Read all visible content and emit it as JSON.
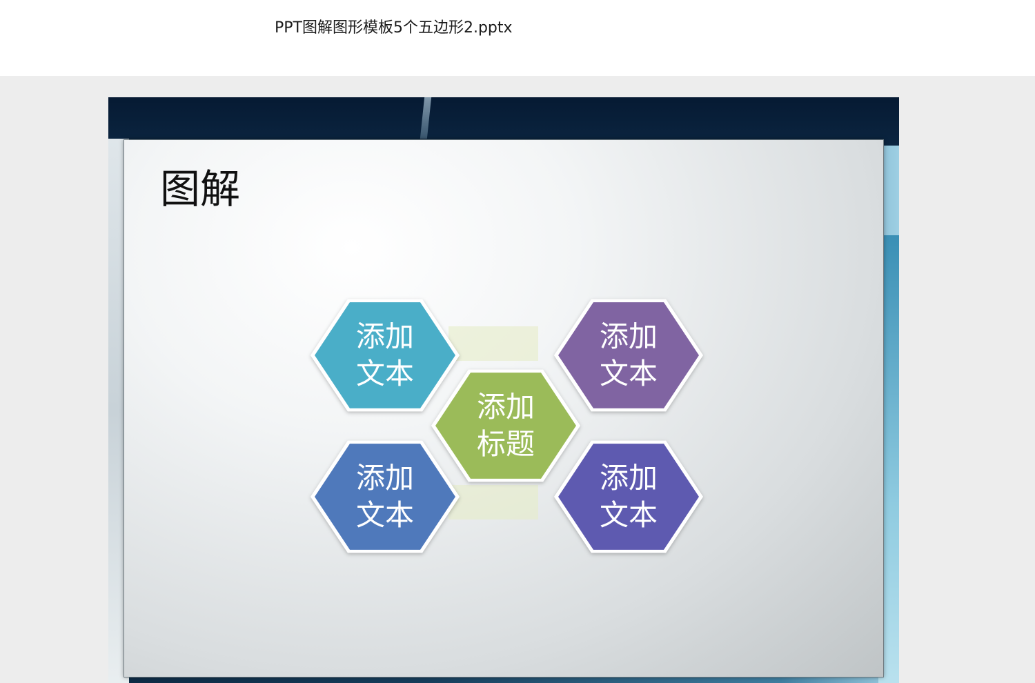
{
  "window": {
    "document_title": "PPT图解图形模板5个五边形2.pptx"
  },
  "slide": {
    "heading": "图解",
    "hexagons": [
      {
        "id": "top-left",
        "text": "添加\n文本",
        "color": "#4aaec8"
      },
      {
        "id": "center",
        "text": "添加\n标题",
        "color": "#9bbb59"
      },
      {
        "id": "top-right",
        "text": "添加\n文本",
        "color": "#8064a2"
      },
      {
        "id": "bottom-left",
        "text": "添加\n文本",
        "color": "#4f79bb"
      },
      {
        "id": "bottom-right",
        "text": "添加\n文本",
        "color": "#5e5ab0"
      }
    ]
  }
}
